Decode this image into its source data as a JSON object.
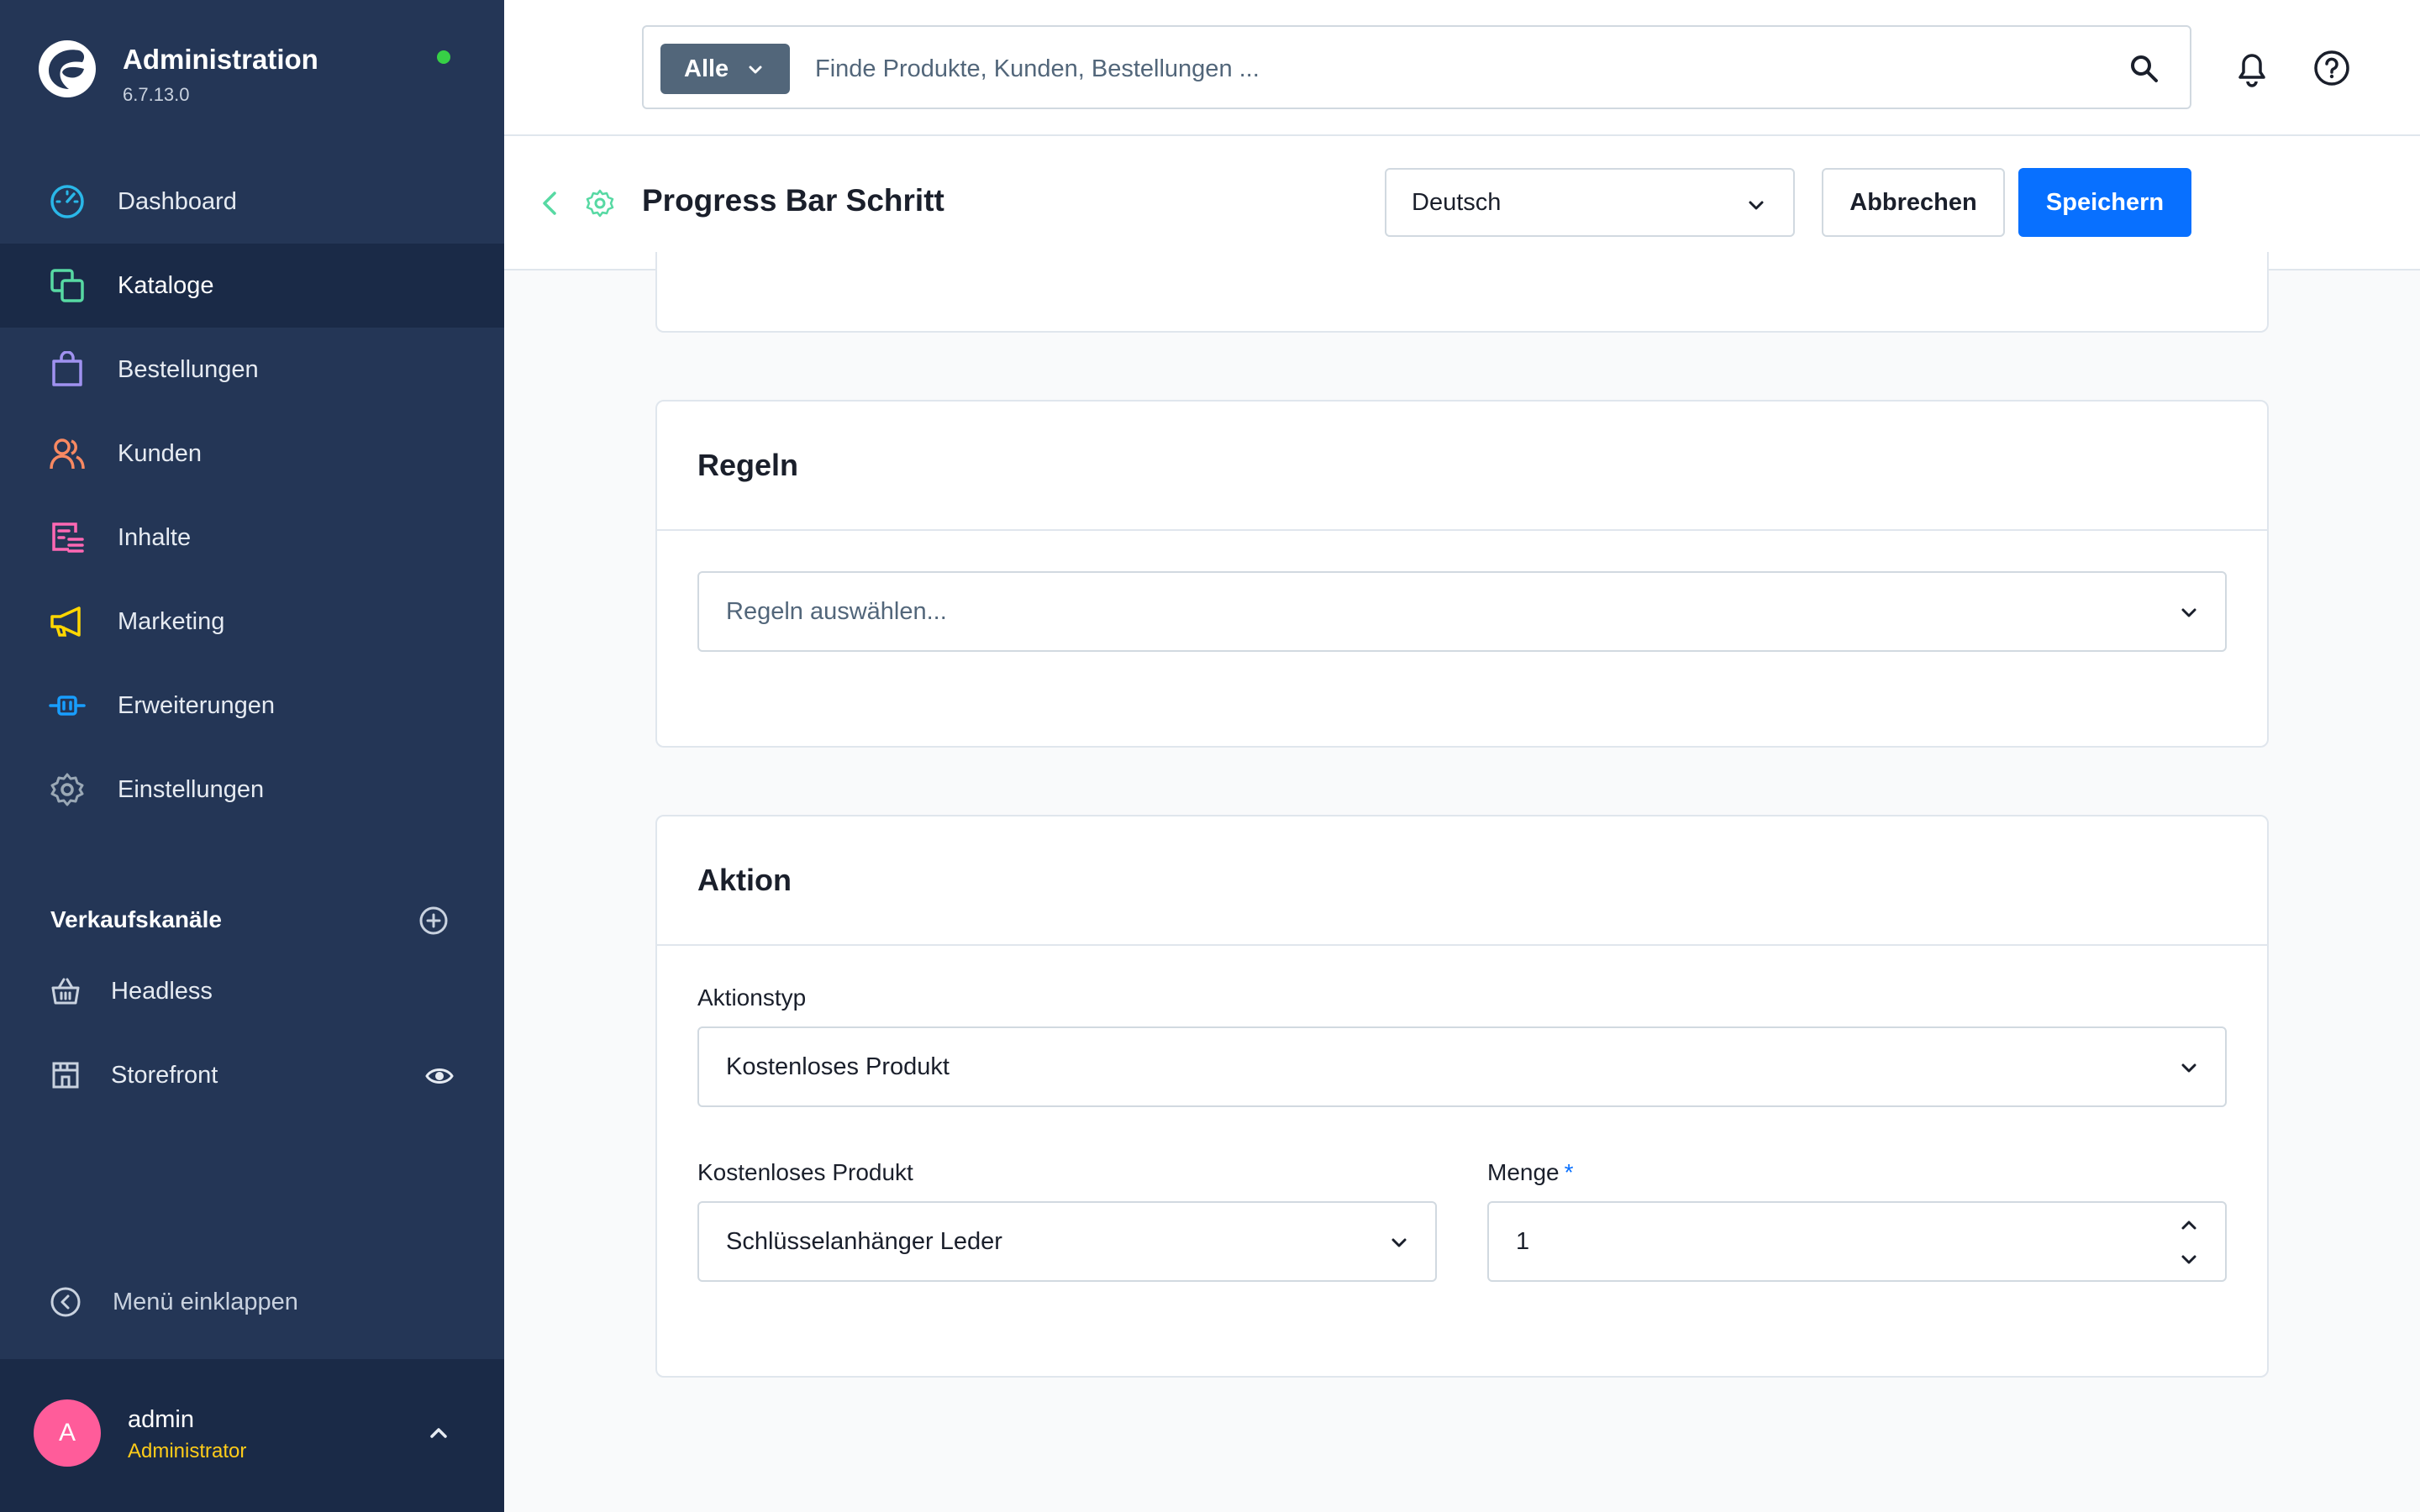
{
  "app": {
    "title": "Administration",
    "version": "6.7.13.0"
  },
  "sidebar": {
    "items": [
      {
        "label": "Dashboard",
        "icon": "dashboard-icon",
        "color": "#2ab7e8"
      },
      {
        "label": "Kataloge",
        "icon": "catalog-icon",
        "color": "#57d9a3",
        "active": true
      },
      {
        "label": "Bestellungen",
        "icon": "orders-bag-icon",
        "color": "#a092f0"
      },
      {
        "label": "Kunden",
        "icon": "customers-icon",
        "color": "#f88962"
      },
      {
        "label": "Inhalte",
        "icon": "content-icon",
        "color": "#ff68b4"
      },
      {
        "label": "Marketing",
        "icon": "marketing-megaphone-icon",
        "color": "#ffd700"
      },
      {
        "label": "Erweiterungen",
        "icon": "extensions-plug-icon",
        "color": "#189eff"
      },
      {
        "label": "Einstellungen",
        "icon": "settings-gear-icon",
        "color": "#9aa8b5"
      }
    ],
    "channels_title": "Verkaufskanäle",
    "channels": [
      {
        "label": "Headless",
        "icon": "basket-icon"
      },
      {
        "label": "Storefront",
        "icon": "storefront-icon"
      }
    ],
    "collapse_label": "Menü einklappen",
    "user": {
      "initial": "A",
      "name": "admin",
      "role": "Administrator"
    }
  },
  "topbar": {
    "search_type": "Alle",
    "search_placeholder": "Finde Produkte, Kunden, Bestellungen ..."
  },
  "smartbar": {
    "title": "Progress Bar Schritt",
    "language": "Deutsch",
    "cancel_label": "Abbrechen",
    "save_label": "Speichern"
  },
  "rules_card": {
    "title": "Regeln",
    "placeholder": "Regeln auswählen..."
  },
  "action_card": {
    "title": "Aktion",
    "action_type_label": "Aktionstyp",
    "action_type_value": "Kostenloses Produkt",
    "free_product_label": "Kostenloses Produkt",
    "free_product_value": "Schlüsselanhänger Leder",
    "quantity_label": "Menge",
    "quantity_required": "*",
    "quantity_value": "1"
  },
  "colors": {
    "sidebar_bg": "#243656",
    "sidebar_active": "#1a2a47",
    "primary": "#0870ff",
    "status_online": "#37d046",
    "avatar": "#ff5c9a",
    "role": "#ffcc19"
  }
}
